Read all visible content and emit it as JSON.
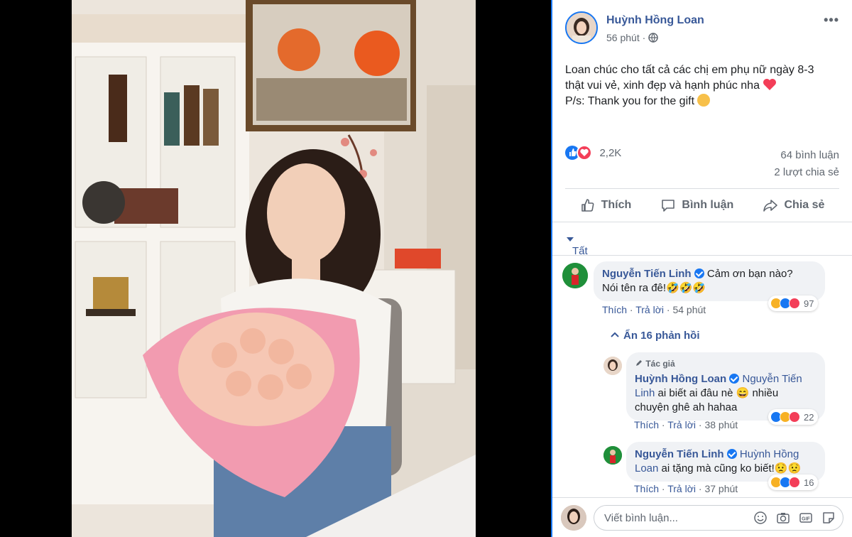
{
  "post": {
    "author": "Huỳnh Hồng Loan",
    "time": "56 phút",
    "text_lines": [
      "Loan chúc cho tất cả các chị em phụ nữ ngày 8-3",
      "thật vui vẻ, xinh đẹp và hạnh phúc nha",
      "P/s: Thank you for the gift"
    ],
    "reaction_count": "2,2K",
    "comments_count": "64 bình luận",
    "shares_count": "2 lượt chia sẻ"
  },
  "actions": {
    "like": "Thích",
    "comment": "Bình luận",
    "share": "Chia sẻ"
  },
  "sort": {
    "label": "Tất cả bình luận"
  },
  "comments": [
    {
      "author": "Nguyễn Tiến Linh",
      "text_line1": "Cảm ơn bạn nào?",
      "text_line2": "Nói tên ra đê!🤣🤣🤣",
      "like": "Thích",
      "reply": "Trả lời",
      "time": "54 phút",
      "reactions": "97"
    }
  ],
  "hide_replies": "Ẩn 16 phản hồi",
  "replies": [
    {
      "tag": "Tác giả",
      "author": "Huỳnh Hồng Loan",
      "mention_part1": "Nguyễn Tiến",
      "mention_part2": "Linh",
      "text_line2": " ai biết ai đâu nè 😄 nhiều",
      "text_line3": "chuyện ghê ah hahaa",
      "like": "Thích",
      "reply": "Trả lời",
      "time": "38 phút",
      "reactions": "22"
    },
    {
      "author": "Nguyễn Tiến Linh",
      "mention_part1": "Huỳnh Hồng",
      "mention_part2": "Loan",
      "text_line2": " ai tặng mà cũng ko biết!😟😟",
      "like": "Thích",
      "reply": "Trả lời",
      "time": "37 phút",
      "reactions": "16"
    }
  ],
  "composer": {
    "placeholder": "Viết bình luận..."
  },
  "colors": {
    "link": "#385898",
    "accent": "#1877f2",
    "love": "#f33e58",
    "haha": "#f7b125"
  },
  "icons": [
    "more-icon",
    "globe-icon",
    "like-icon",
    "comment-icon",
    "share-icon",
    "emoji-icon",
    "camera-icon",
    "gif-icon",
    "sticker-icon"
  ]
}
